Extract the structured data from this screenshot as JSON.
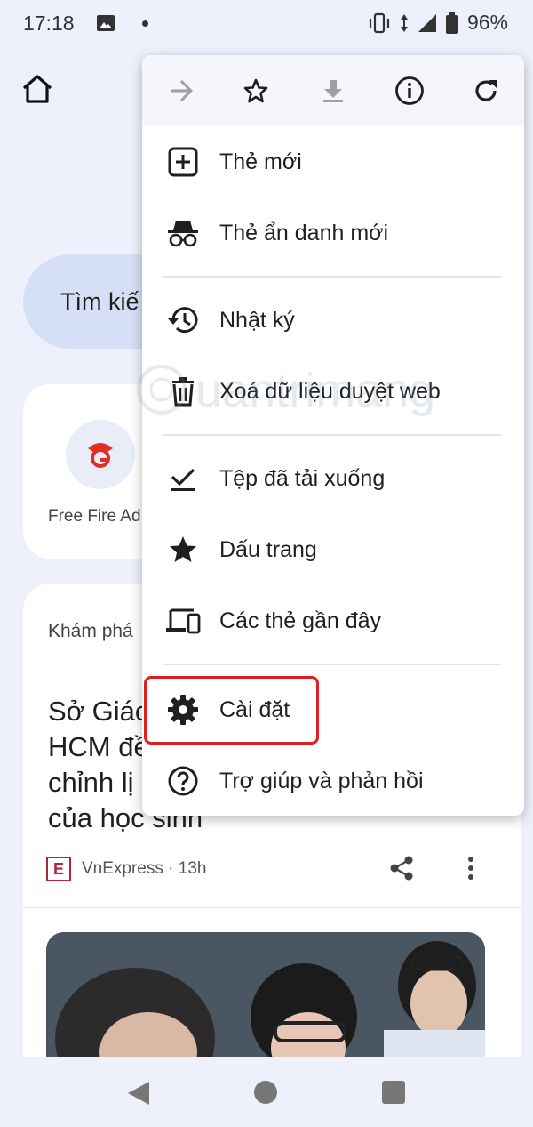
{
  "status_bar": {
    "time": "17:18",
    "battery": "96%"
  },
  "background_page": {
    "search_placeholder": "Tìm kiế",
    "shortcut_label": "Free Fire Ad",
    "discover_title": "Khám phá",
    "headline_lines": [
      "Sở Giác",
      "HCM đề",
      "chỉnh lị",
      "của học sinh"
    ],
    "source": "VnExpress · 13h"
  },
  "menu": {
    "toolbar": [
      {
        "name": "forward",
        "icon": "arrow-right-icon",
        "enabled": false
      },
      {
        "name": "bookmark",
        "icon": "star-outline-icon",
        "enabled": true
      },
      {
        "name": "download",
        "icon": "download-icon",
        "enabled": false
      },
      {
        "name": "page-info",
        "icon": "info-icon",
        "enabled": true
      },
      {
        "name": "reload",
        "icon": "reload-icon",
        "enabled": true
      }
    ],
    "items": [
      {
        "label": "Thẻ mới",
        "icon": "new-tab-icon"
      },
      {
        "label": "Thẻ ẩn danh mới",
        "icon": "incognito-icon"
      },
      {
        "label": "Nhật ký",
        "icon": "history-icon"
      },
      {
        "label": "Xoá dữ liệu duyệt web",
        "icon": "trash-icon"
      },
      {
        "label": "Tệp đã tải xuống",
        "icon": "downloads-check-icon"
      },
      {
        "label": "Dấu trang",
        "icon": "star-filled-icon"
      },
      {
        "label": "Các thẻ gần đây",
        "icon": "devices-icon"
      },
      {
        "label": "Cài đặt",
        "icon": "gear-icon",
        "highlighted": true
      },
      {
        "label": "Trợ giúp và phản hồi",
        "icon": "help-icon"
      }
    ]
  },
  "colors": {
    "highlight": "#e0201f",
    "search_pill": "#d5e0f6",
    "background": "#eef1fb"
  },
  "watermark_text": "uantrimang"
}
